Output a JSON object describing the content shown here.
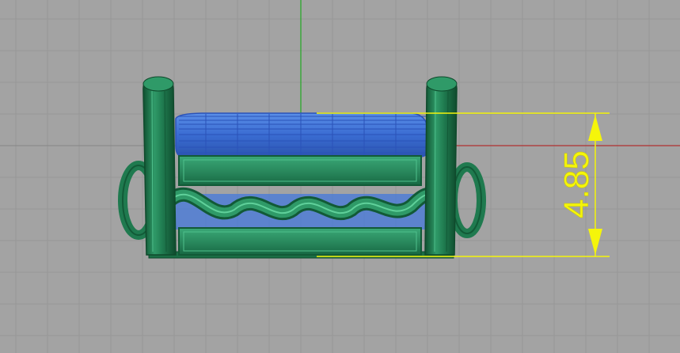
{
  "viewport": {
    "view": "Front",
    "background_color": "#a3a3a3",
    "grid_minor_color": "#979797",
    "grid_major_color": "#8a8a8a"
  },
  "axes": {
    "x_axis_color": "#b03030",
    "y_axis_color": "#22aa22"
  },
  "model": {
    "description_icon": "ring-model",
    "frame_color": "#1f7a4f",
    "frame_dark_color": "#125a37",
    "gem_color": "#3f72d6",
    "gem_wire_color": "#2a52b8"
  },
  "dimension": {
    "value": "4.85",
    "color": "#f5f50a"
  }
}
